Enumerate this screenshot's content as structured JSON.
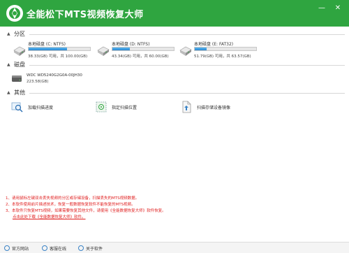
{
  "app": {
    "title": "全能松下MTS视频恢复大师",
    "brand_color": "#2fa540"
  },
  "window_controls": {
    "minimize": "—",
    "close": "✕"
  },
  "sections": {
    "partitions": "分区",
    "disks": "磁盘",
    "other": "其他"
  },
  "partitions": [
    {
      "name": "本地磁盘 (C: NTFS)",
      "size": "38.33(GB) 可用，共 100.00(GB)",
      "used_fraction": 0.62
    },
    {
      "name": "本地磁盘 (D: NTFS)",
      "size": "43.34(GB) 可用，共 60.00(GB)",
      "used_fraction": 0.28
    },
    {
      "name": "本地磁盘 (E: FAT32)",
      "size": "51.79(GB) 可用，共 63.57(GB)",
      "used_fraction": 0.19
    }
  ],
  "disk": {
    "name": "WDC WD5240G2G0A-00JH30",
    "size": "223.58(GB)"
  },
  "other_items": [
    {
      "label": "加载扫描进度",
      "icon": "search-icon"
    },
    {
      "label": "指定扫描位置",
      "icon": "target-icon"
    },
    {
      "label": "扫描存储设备镜像",
      "icon": "file-icon"
    }
  ],
  "notes": {
    "line1": "1、请用鼠标左键双击丢失视频的分区或存储设备，扫描丢失的MTS视频数据。",
    "line2": "2、本软件使用前片描述技术，恢复一般数据恢复软件不能恢复的MTS视频。",
    "line3": "3、本软件只恢复MTS视频，如果需要恢复其他文件，请使用《全能数据恢复大师》软件恢复。",
    "line4": "点击此处下载《全能数据恢复大师》软件。"
  },
  "footer": {
    "website": "官方网站",
    "online_help": "客服在线",
    "about": "关于软件"
  }
}
